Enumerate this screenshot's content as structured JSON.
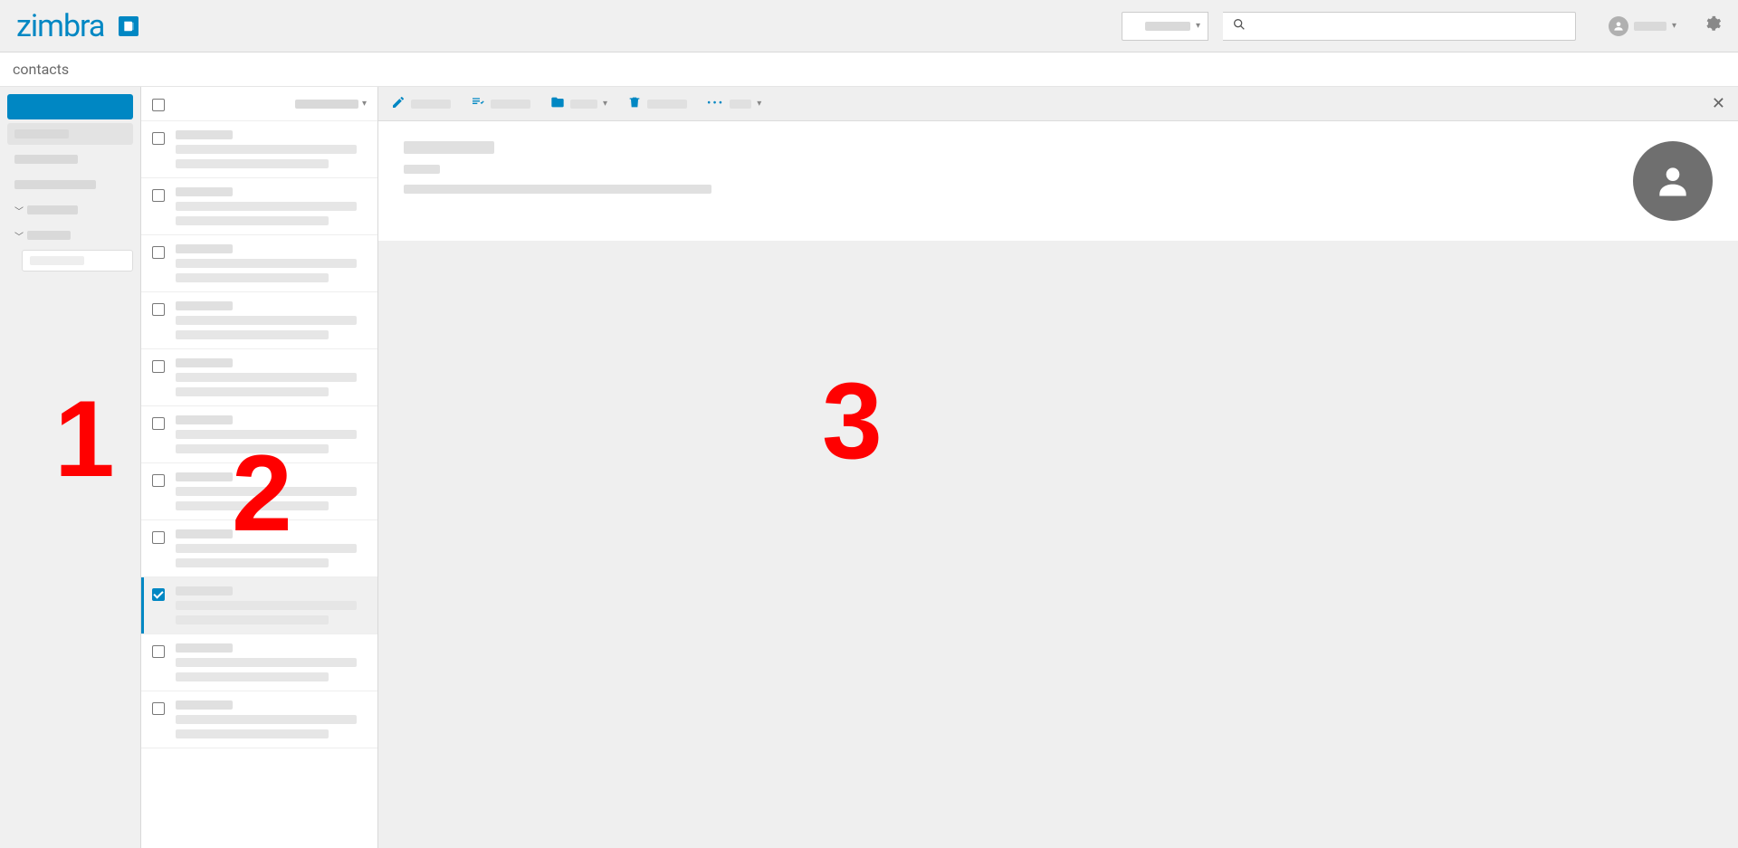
{
  "brand": "zimbra",
  "breadcrumb": "contacts",
  "search": {
    "placeholder": "",
    "scope": ""
  },
  "sidebar": {
    "new_label": "",
    "items": [
      {
        "label": "",
        "active": true
      },
      {
        "label": "",
        "active": false
      },
      {
        "label": "",
        "active": false
      }
    ],
    "groups": [
      {
        "label": "",
        "expanded": true
      },
      {
        "label": "",
        "expanded": true
      }
    ],
    "sub": {
      "label": ""
    }
  },
  "list": {
    "sort_label": "",
    "rows": [
      {
        "selected": false
      },
      {
        "selected": false
      },
      {
        "selected": false
      },
      {
        "selected": false
      },
      {
        "selected": false
      },
      {
        "selected": false
      },
      {
        "selected": false
      },
      {
        "selected": false
      },
      {
        "selected": true
      },
      {
        "selected": false
      },
      {
        "selected": false
      }
    ]
  },
  "toolbar": {
    "edit": {
      "label": ""
    },
    "assign": {
      "label": ""
    },
    "move": {
      "label": ""
    },
    "delete": {
      "label": ""
    },
    "more": {
      "label": ""
    }
  },
  "detail": {
    "name": "",
    "subtitle": "",
    "line": ""
  },
  "annotations": {
    "pane1": "1",
    "pane2": "2",
    "pane3": "3"
  },
  "colors": {
    "accent": "#0087c3",
    "annotation": "#ff0000"
  }
}
